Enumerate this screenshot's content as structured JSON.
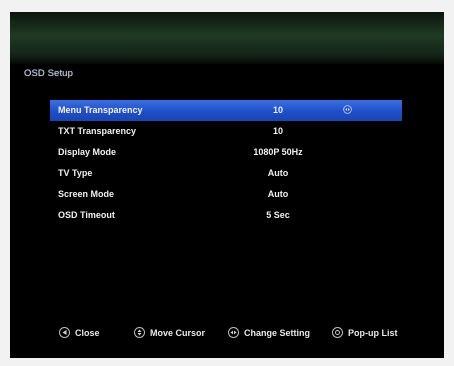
{
  "header": {
    "title": "OSD Setup"
  },
  "menu": {
    "items": [
      {
        "label": "Menu Transparency",
        "value": "10",
        "selected": true
      },
      {
        "label": "TXT Transparency",
        "value": "10",
        "selected": false
      },
      {
        "label": "Display Mode",
        "value": "1080P 50Hz",
        "selected": false
      },
      {
        "label": "TV Type",
        "value": "Auto",
        "selected": false
      },
      {
        "label": "Screen Mode",
        "value": "Auto",
        "selected": false
      },
      {
        "label": "OSD Timeout",
        "value": "5 Sec",
        "selected": false
      }
    ]
  },
  "footer": {
    "close_label": "Close",
    "move_cursor_label": "Move Cursor",
    "change_setting_label": "Change Setting",
    "popup_list_label": "Pop-up List"
  },
  "icons": {
    "close": "exit-icon",
    "move_cursor": "up-down-icon",
    "change_setting": "left-right-icon",
    "popup_list": "ok-icon",
    "value_arrow": "left-right-arrow-icon"
  },
  "colors": {
    "selected_row": "#1f4fc7",
    "background": "#000000",
    "header_band": "#1f3a22",
    "text": "#f1f1f1"
  }
}
